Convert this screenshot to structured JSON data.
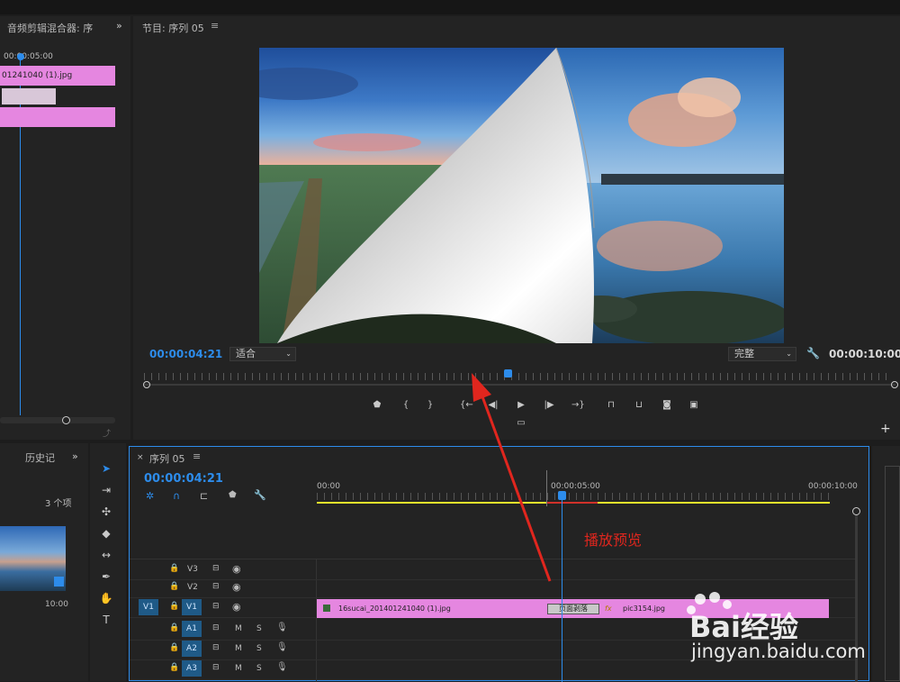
{
  "left_panel": {
    "title": "音频剪辑混合器: 序",
    "timecode": "00:00:05:00",
    "clip_name": "01241040 (1).jpg"
  },
  "program": {
    "title": "节目: 序列 05",
    "current_time": "00:00:04:21",
    "zoom_select": "适合",
    "quality_select": "完整",
    "duration": "00:00:10:00",
    "playhead_fraction": 0.485
  },
  "history_panel": {
    "title": "历史记",
    "item_count": "3 个项",
    "thumb_duration": "10:00"
  },
  "timeline": {
    "tab_title": "序列 05",
    "timecode": "00:00:04:21",
    "ruler": [
      "00:00",
      "00:00:05:00",
      "00:00:10:00"
    ],
    "playhead_fraction": 0.477,
    "tracks_video": [
      {
        "patch": "",
        "name": "V3"
      },
      {
        "patch": "",
        "name": "V2"
      },
      {
        "patch": "V1",
        "name": "V1"
      }
    ],
    "tracks_audio": [
      {
        "name": "A1",
        "m": "M",
        "s": "S"
      },
      {
        "name": "A2",
        "m": "M",
        "s": "S"
      },
      {
        "name": "A3",
        "m": "M",
        "s": "S"
      }
    ],
    "clip1_name": "16sucai_201401241040 (1).jpg",
    "transition_name": "页面剥落",
    "clip2_name": "pic3154.jpg"
  },
  "annotation": {
    "label": "播放预览",
    "color": "#e0261e"
  },
  "watermark": {
    "brand": "Bai经验",
    "url": "jingyan.baidu.com"
  }
}
